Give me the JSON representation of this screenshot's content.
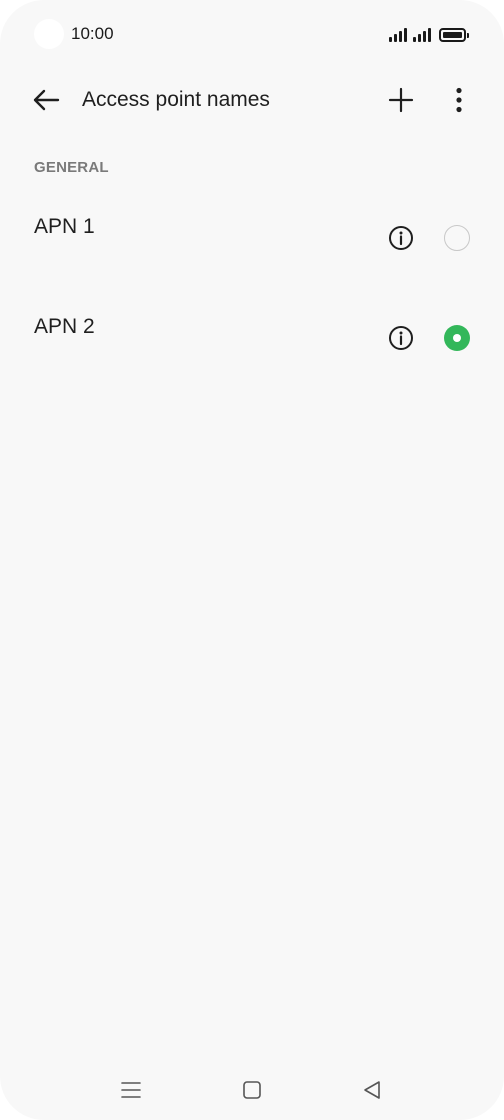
{
  "status_bar": {
    "time": "10:00",
    "icons": [
      "signal-icon",
      "signal-icon",
      "battery-icon"
    ]
  },
  "app_bar": {
    "title": "Access point names",
    "back_icon": "arrow-left-icon",
    "add_icon": "plus-icon",
    "more_icon": "more-vertical-icon"
  },
  "section": {
    "header": "GENERAL"
  },
  "apns": [
    {
      "name": "APN 1",
      "selected": false,
      "info_icon": "info-icon"
    },
    {
      "name": "APN 2",
      "selected": true,
      "info_icon": "info-icon"
    }
  ],
  "nav_bar": {
    "icons": [
      "menu-icon",
      "home-square-icon",
      "back-triangle-icon"
    ]
  },
  "colors": {
    "background": "#f8f8f8",
    "accent": "#33b75a",
    "text": "#1f1f1f",
    "section_header": "#7a7a7a",
    "radio_off_border": "#c8c8c8"
  }
}
